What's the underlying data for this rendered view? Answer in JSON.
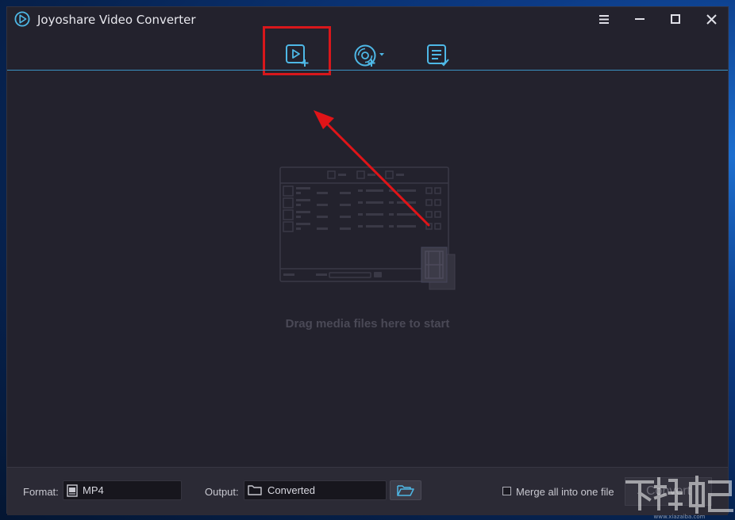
{
  "app": {
    "title": "Joyoshare Video Converter"
  },
  "window_controls": {
    "menu": "menu-icon",
    "minimize": "minimize-icon",
    "maximize": "maximize-icon",
    "close": "close-icon"
  },
  "toolbar": {
    "add_files": "video-add-icon",
    "load_dvd": "dvd-load-icon",
    "task_list": "task-list-icon"
  },
  "main": {
    "drop_hint": "Drag media files here to start"
  },
  "bottom": {
    "format_label": "Format:",
    "format_value": "MP4",
    "output_label": "Output:",
    "output_value": "Converted",
    "merge_label": "Merge all into one file",
    "merge_checked": false,
    "convert_label": "Convert"
  },
  "colors": {
    "accent": "#4eb8e6",
    "highlight": "#d8171b",
    "window_bg": "#23222d"
  }
}
